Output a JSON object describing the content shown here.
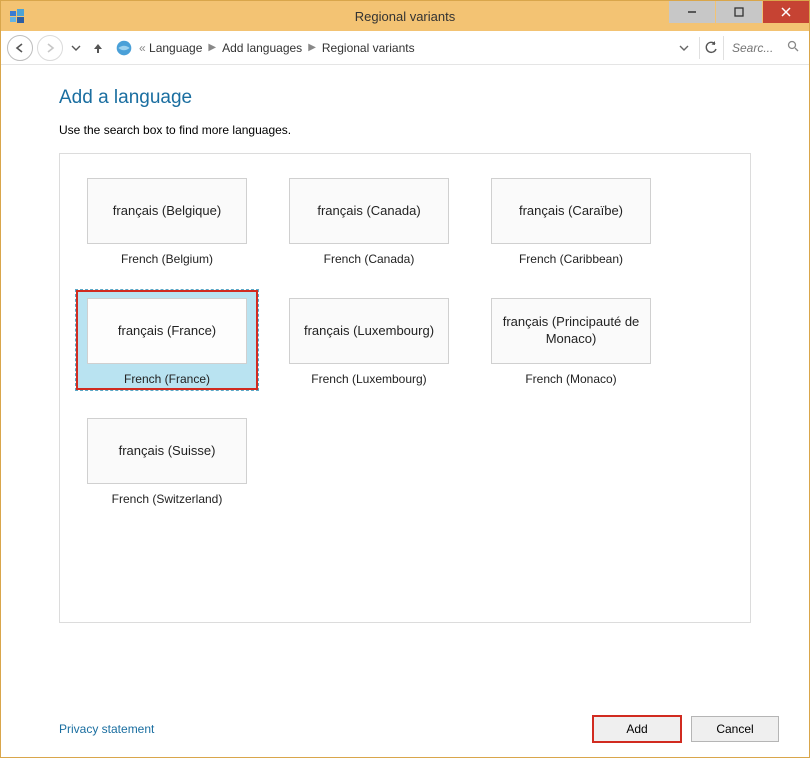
{
  "window": {
    "title": "Regional variants"
  },
  "breadcrumb": {
    "level1": "Language",
    "level2": "Add languages",
    "level3": "Regional variants"
  },
  "search": {
    "placeholder": "Searc..."
  },
  "page": {
    "heading": "Add a language",
    "subtext": "Use the search box to find more languages."
  },
  "variants": [
    {
      "native": "français (Belgique)",
      "english": "French (Belgium)",
      "selected": false
    },
    {
      "native": "français (Canada)",
      "english": "French (Canada)",
      "selected": false
    },
    {
      "native": "français (Caraïbe)",
      "english": "French (Caribbean)",
      "selected": false
    },
    {
      "native": "français (France)",
      "english": "French (France)",
      "selected": true
    },
    {
      "native": "français (Luxembourg)",
      "english": "French (Luxembourg)",
      "selected": false
    },
    {
      "native": "français (Principauté de Monaco)",
      "english": "French (Monaco)",
      "selected": false
    },
    {
      "native": "français (Suisse)",
      "english": "French (Switzerland)",
      "selected": false
    }
  ],
  "footer": {
    "privacy": "Privacy statement",
    "add": "Add",
    "cancel": "Cancel"
  }
}
